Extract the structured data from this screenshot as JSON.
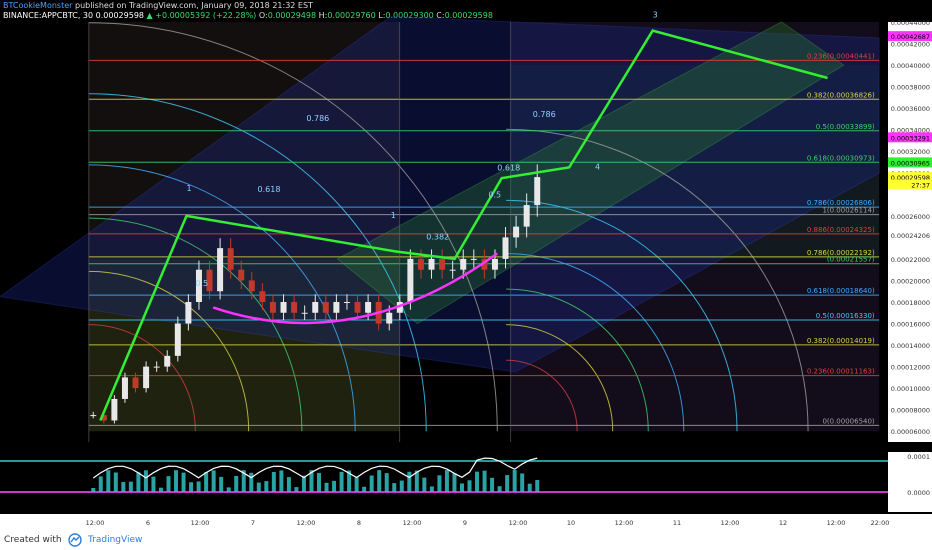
{
  "header": {
    "author": "BTCookieMonster",
    "published_text": "published on TradingView.com, January 09, 2018 21:32 EST",
    "symbol": "BINANCE:APPCBTC, 30",
    "last": "0.00029598",
    "change": "+0.00005392 (+22.28%)",
    "o_label": "O:",
    "o_value": "0.00029498",
    "h_label": "H:",
    "h_value": "0.00029760",
    "l_label": "L:",
    "l_value": "0.00029300",
    "c_label": "C:",
    "c_value": "0.00029598"
  },
  "footer": {
    "created_with": "Created with",
    "brand": "TradingView"
  },
  "colors": {
    "background": "#000000",
    "candle_up": "#e8e8e8",
    "candle_down": "#c0392b",
    "trend": "#33ee33",
    "fib_magenta": "#ff33ff",
    "axis_text": "#cccccc"
  },
  "chart_data": {
    "type": "line",
    "title": "BINANCE:APPCBTC, 30",
    "ylim": [
      5e-05,
      0.00044
    ],
    "x_ticks": [
      "12:00",
      "6",
      "12:00",
      "7",
      "12:00",
      "8",
      "12:00",
      "9",
      "12:00",
      "10",
      "12:00",
      "11",
      "12:00",
      "12",
      "12:00",
      "22:00"
    ],
    "y_ticks": [
      "0.00044000",
      "0.00042000",
      "0.00040000",
      "0.00038000",
      "0.00036000",
      "0.00034000",
      "0.00032000",
      "0.00030000",
      "0.00026000",
      "0.00024206",
      "0.00022000",
      "0.00020000",
      "0.00018000",
      "0.00016000",
      "0.00014000",
      "0.00012000",
      "0.00010000",
      "0.00008000",
      "0.00006000"
    ],
    "price_badges": [
      {
        "label": "0.00042687",
        "value": 0.00042687,
        "color": "#ff33ff"
      },
      {
        "label": "0.00033291",
        "value": 0.00033291,
        "color": "#ff33ff"
      },
      {
        "label": "0.00030965",
        "value": 0.00030965,
        "color": "#33ee33"
      },
      {
        "label": "0.00029598",
        "value": 0.00029598,
        "color": "#ffff33"
      },
      {
        "label": "27:37",
        "value": 0.000289,
        "color": "#ffff33"
      }
    ],
    "fib_levels": [
      {
        "label": "0.236(0.00040441)",
        "value": 0.00040441,
        "color": "#e04040"
      },
      {
        "label": "0.382(0.00036826)",
        "value": 0.00036826,
        "color": "#d8d840"
      },
      {
        "label": "0.5(0.00033899)",
        "value": 0.00033899,
        "color": "#40d070"
      },
      {
        "label": "0.618(0.00030973)",
        "value": 0.00030973,
        "color": "#40d070"
      },
      {
        "label": "0.786(0.00026806)",
        "value": 0.00026806,
        "color": "#40b0ff"
      },
      {
        "label": "1(0.00026114)",
        "value": 0.00026114,
        "color": "#a0a0a0"
      },
      {
        "label": "0.886(0.00024325)",
        "value": 0.00024325,
        "color": "#e04040"
      },
      {
        "label": "0.786(0.00022192)",
        "value": 0.00022192,
        "color": "#d8d840"
      },
      {
        "label": "(0.00021557)",
        "value": 0.00021557,
        "color": "#40d070"
      },
      {
        "label": "0.618(0.00018640)",
        "value": 0.0001864,
        "color": "#40b0ff"
      },
      {
        "label": "0.5(0.00016330)",
        "value": 0.0001633,
        "color": "#40d0ff"
      },
      {
        "label": "0.382(0.00014019)",
        "value": 0.00014019,
        "color": "#d8d840"
      },
      {
        "label": "0.236(0.00011163)",
        "value": 0.00011163,
        "color": "#e04040"
      },
      {
        "label": "0(0.00006540)",
        "value": 6.54e-05,
        "color": "#a0a0a0"
      }
    ],
    "annotations": [
      {
        "text": "0.786",
        "x": 0.345,
        "y": 0.000348
      },
      {
        "text": "0.618",
        "x": 0.29,
        "y": 0.000282
      },
      {
        "text": "0.5",
        "x": 0.22,
        "y": 0.000195
      },
      {
        "text": "0.382",
        "x": 0.48,
        "y": 0.000238
      },
      {
        "text": "0.786",
        "x": 0.6,
        "y": 0.000352
      },
      {
        "text": "0.618",
        "x": 0.56,
        "y": 0.000302
      },
      {
        "text": "0.5",
        "x": 0.55,
        "y": 0.000277
      },
      {
        "text": "4",
        "x": 0.67,
        "y": 0.000303
      },
      {
        "text": "1",
        "x": 0.44,
        "y": 0.000258
      },
      {
        "text": "1",
        "x": 0.21,
        "y": 0.000283
      },
      {
        "text": "3",
        "x": 0.735,
        "y": 0.000444
      }
    ],
    "trend_points_x": [
      0.113,
      0.21,
      0.445,
      0.512,
      0.565,
      0.641,
      0.735,
      0.932
    ],
    "trend_points_y": [
      7e-05,
      0.00026,
      0.000227,
      0.00022,
      0.000295,
      0.000305,
      0.000432,
      0.000388
    ],
    "close_series": [
      7.5e-05,
      7e-05,
      9e-05,
      0.00011,
      0.0001,
      0.00012,
      0.00012,
      0.00013,
      0.00016,
      0.00018,
      0.00021,
      0.00019,
      0.00023,
      0.00021,
      0.0002,
      0.00019,
      0.00018,
      0.00017,
      0.00018,
      0.00017,
      0.00017,
      0.00018,
      0.00017,
      0.00018,
      0.00018,
      0.00017,
      0.00018,
      0.00016,
      0.00017,
      0.00018,
      0.00022,
      0.00021,
      0.00022,
      0.00021,
      0.00021,
      0.00022,
      0.00022,
      0.00021,
      0.00022,
      0.00024,
      0.00025,
      0.00027,
      0.00029598
    ],
    "indicator_ticks": [
      "0.0001",
      "0.0000"
    ]
  }
}
